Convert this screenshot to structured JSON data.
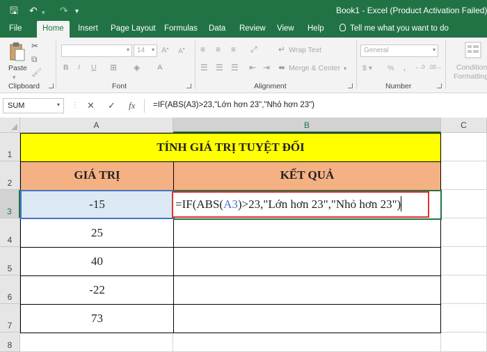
{
  "titlebar": {
    "window_title": "Book1  -  Excel (Product Activation Failed)"
  },
  "menu": {
    "tabs": [
      "File",
      "Home",
      "Insert",
      "Page Layout",
      "Formulas",
      "Data",
      "Review",
      "View",
      "Help"
    ],
    "tell_me": "Tell me what you want to do"
  },
  "ribbon": {
    "paste": "Paste",
    "clipboard": "Clipboard",
    "font": "Font",
    "font_size": "14",
    "alignment": "Alignment",
    "wrap_text": "Wrap Text",
    "merge_center": "Merge & Center",
    "number": "Number",
    "number_format": "General",
    "conditional_formatting_1": "Condition",
    "conditional_formatting_2": "Formatting"
  },
  "formula_bar": {
    "name_box": "SUM",
    "fx": "fx",
    "formula": "=IF(ABS(A3)>23,\"Lớn hơn 23\",\"Nhỏ hơn 23\")"
  },
  "sheet": {
    "columns": [
      "A",
      "B",
      "C"
    ],
    "rows": [
      "1",
      "2",
      "3",
      "4",
      "5",
      "6",
      "7",
      "8"
    ],
    "title": "TÍNH GIÁ TRỊ TUYỆT ĐỐI",
    "header_a": "GIÁ TRỊ",
    "header_b": "KẾT QUẢ",
    "values": [
      "-15",
      "25",
      "40",
      "-22",
      "73"
    ],
    "editor": {
      "pre": "=IF(ABS(",
      "ref": "A3",
      "post": ")>23,\"Lớn hơn 23\",\"Nhỏ hơn 23\")"
    }
  },
  "colors": {
    "excel_green": "#217346",
    "title_fill": "#ffff00",
    "header_fill": "#f4b183",
    "selection_fill": "#dde8f5",
    "edit_border": "#e03030",
    "reference_blue": "#4472c4"
  }
}
